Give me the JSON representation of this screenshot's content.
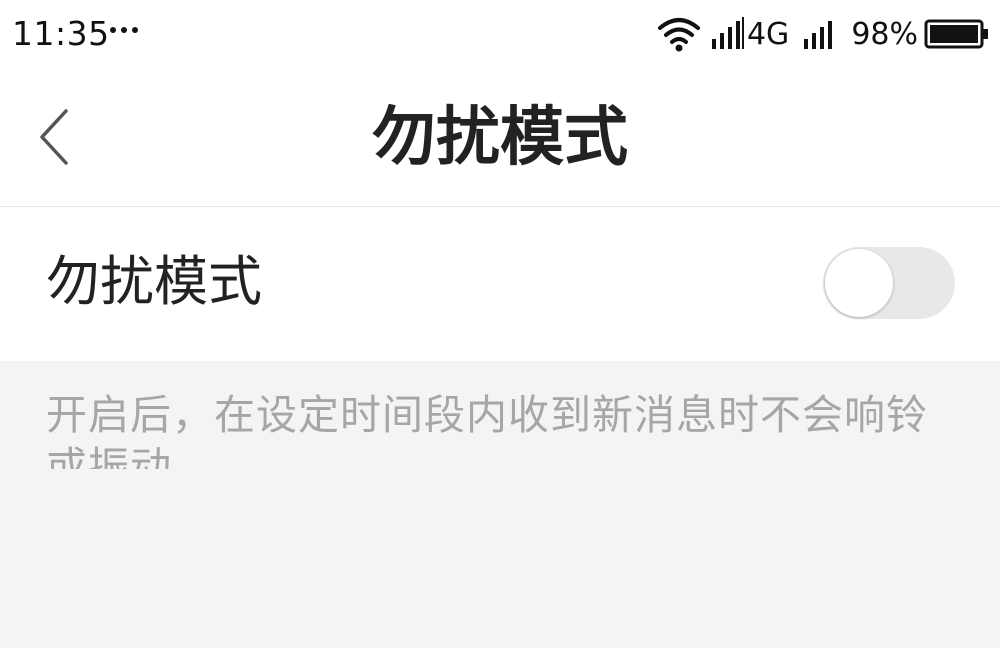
{
  "status_bar": {
    "time": "11:35",
    "network": "4G",
    "battery": "98%",
    "icons": [
      "more-dots-icon",
      "wifi-icon",
      "signal-icon",
      "signal-icon",
      "battery-icon"
    ]
  },
  "nav": {
    "back_icon": "chevron-left-icon",
    "title": "勿扰模式"
  },
  "setting": {
    "label": "勿扰模式",
    "toggle_state": "off",
    "toggle_colors": {
      "track": "#e8e8e8",
      "knob": "#ffffff"
    }
  },
  "description": "开启后，在设定时间段内收到新消息时不会响铃或振动。",
  "colors": {
    "background": "#f4f4f4",
    "surface": "#ffffff",
    "text_primary": "#222222",
    "text_secondary": "#a6a6a6"
  }
}
